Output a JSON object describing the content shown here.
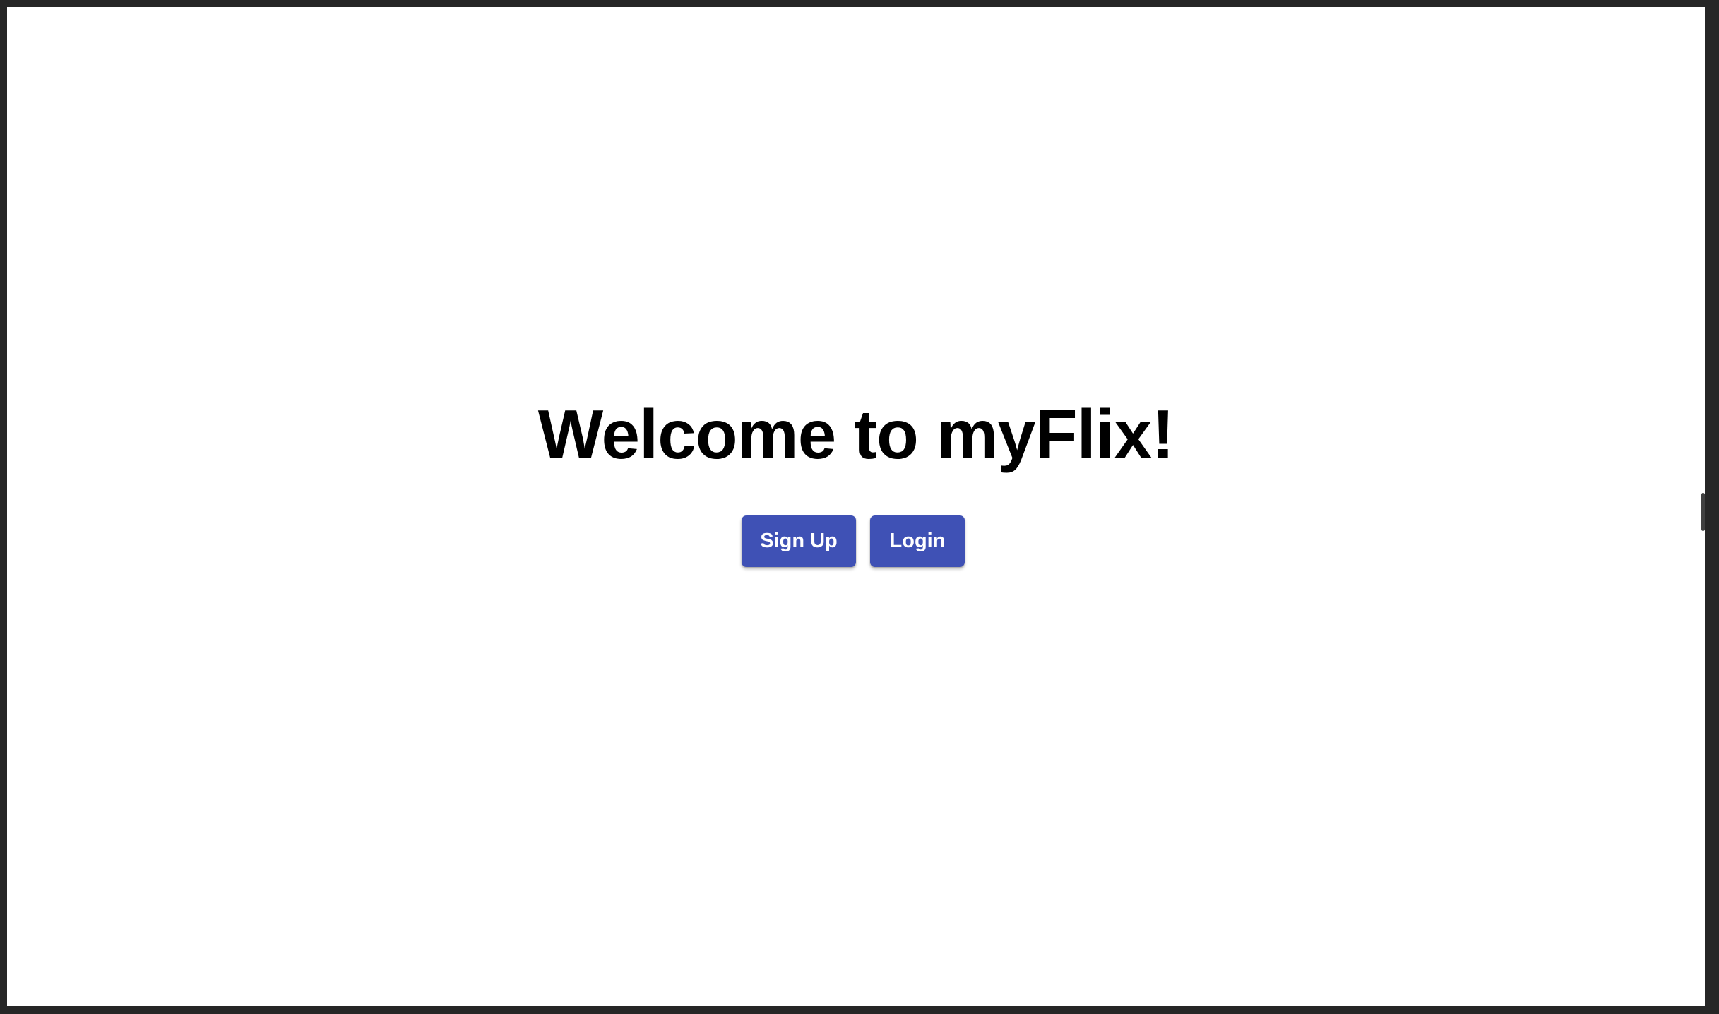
{
  "page": {
    "title": "Welcome to myFlix!"
  },
  "actions": {
    "signup_label": "Sign Up",
    "login_label": "Login"
  },
  "theme": {
    "button_color": "#3F51B5",
    "frame_color": "#262626",
    "background_color": "#FFFFFF",
    "text_color": "#000000"
  }
}
